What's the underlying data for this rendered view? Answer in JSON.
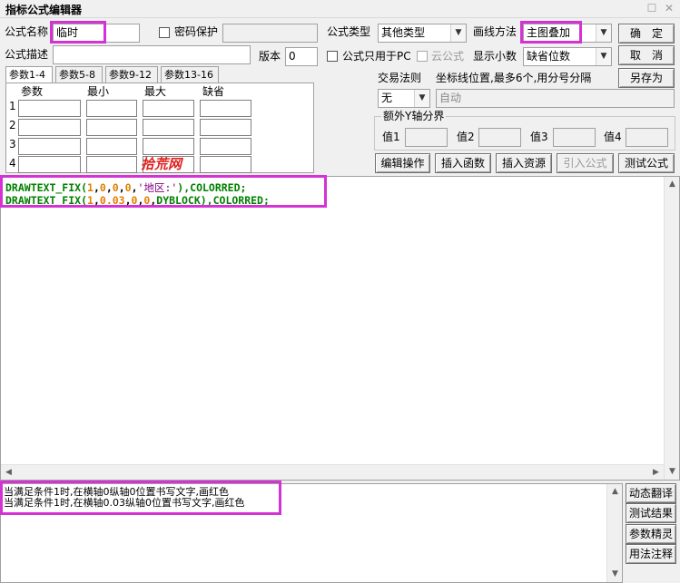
{
  "window": {
    "title": "指标公式编辑器"
  },
  "form": {
    "name_label": "公式名称",
    "name_value": "临时",
    "password_label": "密码保护",
    "desc_label": "公式描述",
    "desc_value": "",
    "version_label": "版本",
    "version_value": "0",
    "type_label": "公式类型",
    "type_value": "其他类型",
    "draw_label": "画线方法",
    "draw_value": "主图叠加",
    "pc_only_label": "公式只用于PC",
    "cloud_label": "云公式",
    "decimals_label": "显示小数",
    "decimals_value": "缺省位数",
    "trade_rule_label": "交易法则",
    "trade_rule_value": "无",
    "axis_label": "坐标线位置,最多6个,用分号分隔",
    "axis_value": "自动",
    "extra_y_label": "额外Y轴分界",
    "y_values": [
      "值1",
      "值2",
      "值3",
      "值4"
    ]
  },
  "buttons": {
    "ok": "确　定",
    "cancel": "取　消",
    "save_as": "另存为",
    "edit_ops": "编辑操作",
    "insert_func": "插入函数",
    "insert_resource": "插入资源",
    "import_formula": "引入公式",
    "test_formula": "测试公式",
    "dyn_translate": "动态翻译",
    "test_result": "测试结果",
    "param_wizard": "参数精灵",
    "usage_notes": "用法注释"
  },
  "tabs": [
    "参数1-4",
    "参数5-8",
    "参数9-12",
    "参数13-16"
  ],
  "params": {
    "headers": [
      "参数",
      "最小",
      "最大",
      "缺省"
    ],
    "rows": [
      "1",
      "2",
      "3",
      "4"
    ]
  },
  "watermark": "拾荒网",
  "code_lines": [
    [
      {
        "t": "DRAWTEXT_FIX(",
        "c": "g"
      },
      {
        "t": "1",
        "c": "o"
      },
      {
        "t": ",",
        "c": "k"
      },
      {
        "t": "0",
        "c": "o"
      },
      {
        "t": ",",
        "c": "k"
      },
      {
        "t": "0",
        "c": "o"
      },
      {
        "t": ",",
        "c": "k"
      },
      {
        "t": "0",
        "c": "o"
      },
      {
        "t": ",",
        "c": "k"
      },
      {
        "t": "'地区:'",
        "c": "p"
      },
      {
        "t": "),COLORRED;",
        "c": "g"
      }
    ],
    [
      {
        "t": "DRAWTEXT_FIX(",
        "c": "g"
      },
      {
        "t": "1",
        "c": "o"
      },
      {
        "t": ",",
        "c": "k"
      },
      {
        "t": "0.03",
        "c": "o"
      },
      {
        "t": ",",
        "c": "k"
      },
      {
        "t": "0",
        "c": "o"
      },
      {
        "t": ",",
        "c": "k"
      },
      {
        "t": "0",
        "c": "o"
      },
      {
        "t": ",",
        "c": "k"
      },
      {
        "t": "DYBLOCK",
        "c": "g"
      },
      {
        "t": "),COLORRED;",
        "c": "g"
      }
    ]
  ],
  "description_lines": [
    "当满足条件1时,在横轴0纵轴0位置书写文字,画红色",
    "当满足条件1时,在横轴0.03纵轴0位置书写文字,画红色"
  ]
}
